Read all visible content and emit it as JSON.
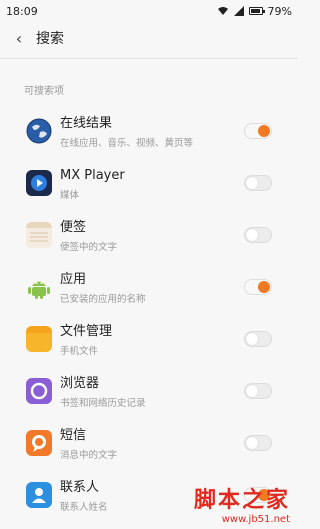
{
  "status": {
    "time": "18:09",
    "battery": "79%"
  },
  "header": {
    "title": "搜索"
  },
  "section": {
    "title": "可搜索项"
  },
  "items": [
    {
      "label": "在线结果",
      "sub": "在线应用、音乐、视频、黄页等",
      "enabled": true,
      "icon": "globe-icon"
    },
    {
      "label": "MX Player",
      "sub": "媒体",
      "enabled": false,
      "icon": "mx-player-icon"
    },
    {
      "label": "便签",
      "sub": "便签中的文字",
      "enabled": false,
      "icon": "notes-icon"
    },
    {
      "label": "应用",
      "sub": "已安装的应用的名称",
      "enabled": true,
      "icon": "android-icon"
    },
    {
      "label": "文件管理",
      "sub": "手机文件",
      "enabled": false,
      "icon": "folder-icon"
    },
    {
      "label": "浏览器",
      "sub": "书签和网络历史记录",
      "enabled": false,
      "icon": "browser-icon"
    },
    {
      "label": "短信",
      "sub": "消息中的文字",
      "enabled": false,
      "icon": "sms-icon"
    },
    {
      "label": "联系人",
      "sub": "联系人姓名",
      "enabled": true,
      "icon": "contacts-icon"
    }
  ],
  "watermark": {
    "big": "脚本之家",
    "small": "www.jb51.net"
  },
  "colors": {
    "accent": "#f07a22"
  }
}
